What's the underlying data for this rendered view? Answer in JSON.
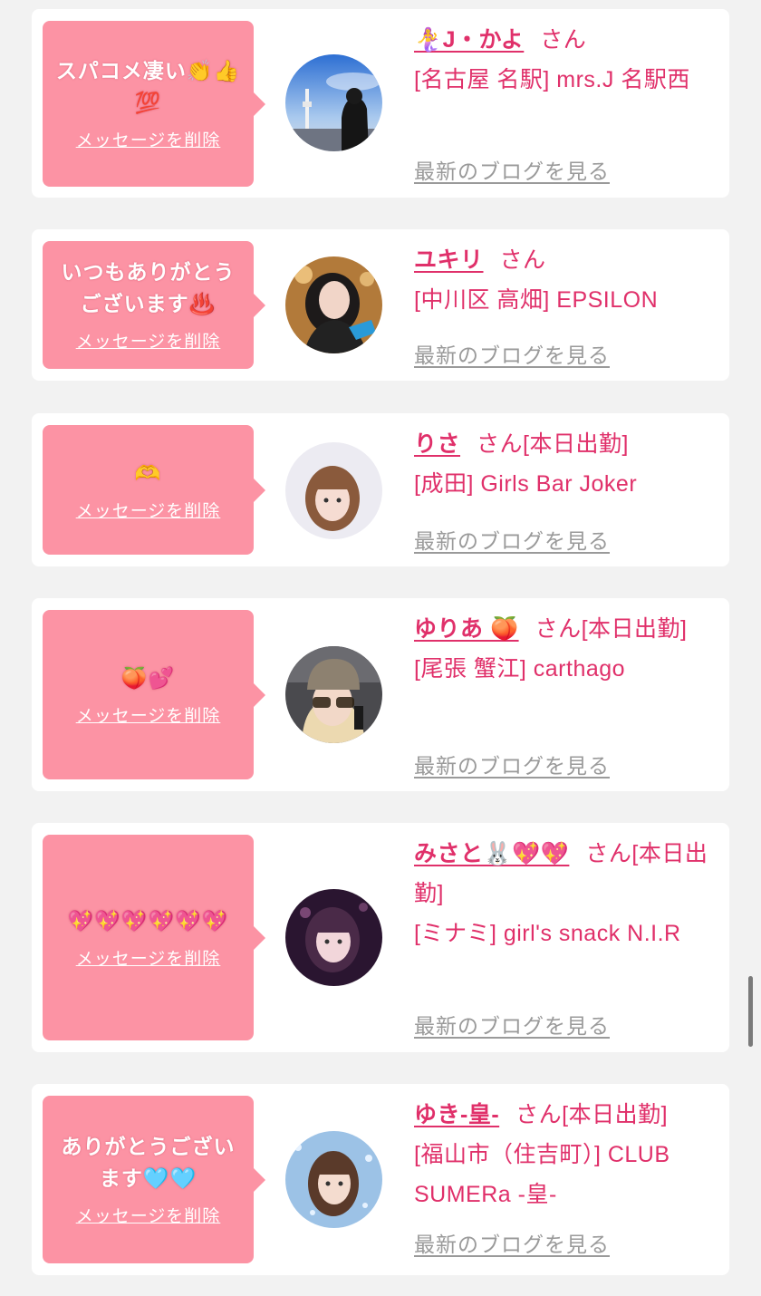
{
  "common": {
    "delete_label": "メッセージを削除",
    "blog_label": "最新のブログを見る",
    "honorific": "さん"
  },
  "colors": {
    "background": "#f2f2f2",
    "card": "#ffffff",
    "bubble": "#fc93a4",
    "accent": "#e0306a",
    "muted": "#9a9a9a"
  },
  "messages": [
    {
      "message": "スパコメ凄い👏👍💯",
      "name": "🧜‍♀️J・かよ",
      "suffix": "さん",
      "shop": "[名古屋 名駅] mrs.J 名駅西",
      "avatar_icon": "avatar-tower-photo"
    },
    {
      "message": "いつもありがとうございます♨️",
      "name": "ユキリ",
      "suffix": "さん",
      "shop": "[中川区 高畑] EPSILON",
      "avatar_icon": "avatar-woman-dark-hair"
    },
    {
      "message": "🫶",
      "name": "りさ",
      "suffix": "さん[本日出勤]",
      "shop": "[成田] Girls Bar Joker",
      "avatar_icon": "avatar-woman-brown-hair"
    },
    {
      "message": "🍑💕",
      "name": "ゆりあ 🍑",
      "suffix": "さん[本日出勤]",
      "shop": "[尾張 蟹江] carthago",
      "avatar_icon": "avatar-woman-beanie"
    },
    {
      "message": "💖💖💖💖💖💖",
      "name": "みさと🐰💖💖",
      "suffix": "さん[本日出勤]",
      "shop": "[ミナミ] girl's snack N.I.R",
      "avatar_icon": "avatar-woman-purple"
    },
    {
      "message": "ありがとうございます🩵🩵",
      "name": "ゆき-皇-",
      "suffix": "さん[本日出勤]",
      "shop": "[福山市（住吉町）] CLUB SUMERa -皇-",
      "avatar_icon": "avatar-woman-blue-glitter"
    }
  ]
}
